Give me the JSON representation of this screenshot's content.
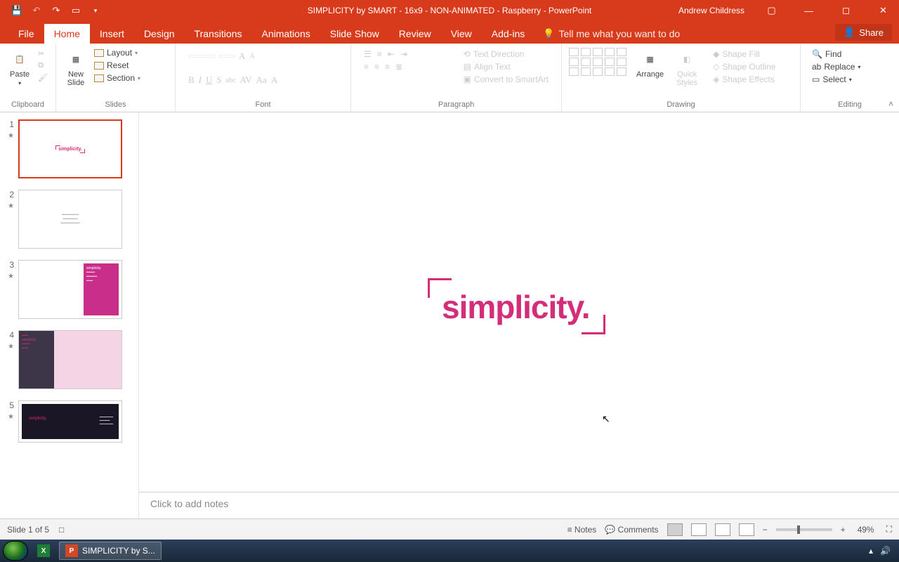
{
  "titlebar": {
    "title": "SIMPLICITY by SMART - 16x9 - NON-ANIMATED - Raspberry - PowerPoint",
    "username": "Andrew Childress"
  },
  "tabs": {
    "file": "File",
    "home": "Home",
    "insert": "Insert",
    "design": "Design",
    "transitions": "Transitions",
    "animations": "Animations",
    "slideshow": "Slide Show",
    "review": "Review",
    "view": "View",
    "addins": "Add-ins",
    "tellme": "Tell me what you want to do",
    "share": "Share"
  },
  "ribbon": {
    "clipboard": {
      "label": "Clipboard",
      "paste": "Paste"
    },
    "slides": {
      "label": "Slides",
      "new_slide": "New\nSlide",
      "layout": "Layout",
      "reset": "Reset",
      "section": "Section"
    },
    "font": {
      "label": "Font"
    },
    "paragraph": {
      "label": "Paragraph",
      "text_direction": "Text Direction",
      "align_text": "Align Text",
      "smartart": "Convert to SmartArt"
    },
    "drawing": {
      "label": "Drawing",
      "arrange": "Arrange",
      "quick_styles": "Quick\nStyles",
      "shape_fill": "Shape Fill",
      "shape_outline": "Shape Outline",
      "shape_effects": "Shape Effects"
    },
    "editing": {
      "label": "Editing",
      "find": "Find",
      "replace": "Replace",
      "select": "Select"
    }
  },
  "slides": [
    {
      "num": "1",
      "has_star": true
    },
    {
      "num": "2",
      "has_star": true
    },
    {
      "num": "3",
      "has_star": true
    },
    {
      "num": "4",
      "has_star": true
    },
    {
      "num": "5",
      "has_star": true
    }
  ],
  "canvas": {
    "main_text": "simplicity."
  },
  "notes": {
    "placeholder": "Click to add notes"
  },
  "statusbar": {
    "slide_info": "Slide 1 of 5",
    "notes": "Notes",
    "comments": "Comments",
    "zoom": "49%"
  },
  "taskbar": {
    "pp_label": "SIMPLICITY by S..."
  }
}
